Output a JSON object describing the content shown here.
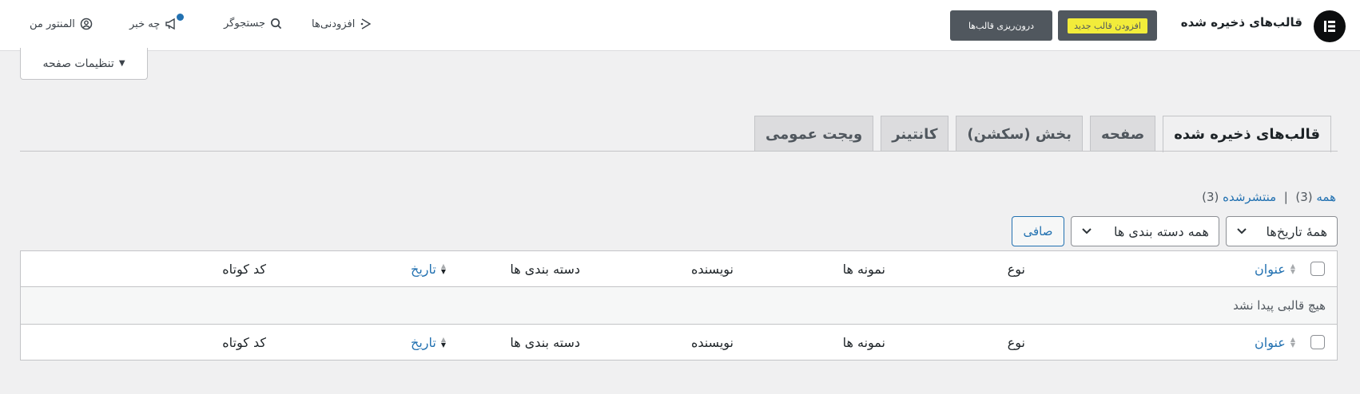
{
  "header": {
    "title": "قالب‌های ذخیره شده",
    "add_new_label": "افزودن قالب جدید",
    "import_label": "درون‌ریزی قالب‌ها",
    "addons_label": "افزودنی‌ها",
    "search_label": "جستجوگر",
    "whats_new_label": "چه خبر",
    "my_elementor_label": "المنتور من"
  },
  "page_settings_label": "تنظیمات صفحه",
  "tabs": [
    {
      "label": "قالب‌های ذخیره شده"
    },
    {
      "label": "صفحه"
    },
    {
      "label": "بخش (سکشن)"
    },
    {
      "label": "کانتینر"
    },
    {
      "label": "ویجت عمومی"
    }
  ],
  "views": {
    "all_label": "همه",
    "all_count": "(3)",
    "separator": "|",
    "published_label": "منتشرشده",
    "published_count": "(3)"
  },
  "filters": {
    "date_select": "همهٔ تاریخ‌ها",
    "category_select": "همه دسته بندی ها",
    "filter_button": "صافی"
  },
  "table": {
    "columns": {
      "title": "عنوان",
      "type": "نوع",
      "samples": "نمونه ها",
      "author": "نویسنده",
      "categories": "دسته بندی ها",
      "date": "تاریخ",
      "shortcode": "کد کوتاه"
    },
    "empty_message": "هیچ قالبی پیدا نشد"
  },
  "colors": {
    "accent": "#2271b1",
    "dark_button": "#50575e",
    "highlight": "#f2ec3a"
  }
}
